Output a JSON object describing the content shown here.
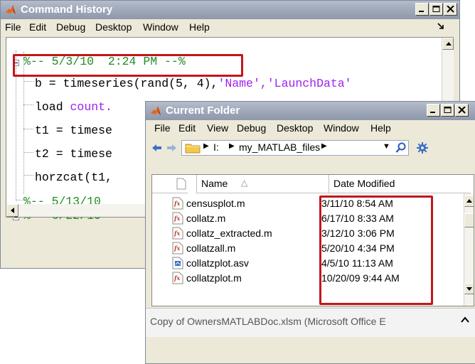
{
  "history": {
    "title": "Command History",
    "menu": [
      "File",
      "Edit",
      "Debug",
      "Desktop",
      "Window",
      "Help"
    ],
    "session1": "%-- 5/3/10  2:24 PM --%",
    "lines": [
      {
        "a": "b = timeseries(rand(5, 4),",
        "b": "'Name','LaunchData'"
      },
      {
        "a": "load ",
        "b": "count."
      },
      {
        "a": "t1 = timese",
        "b": ""
      },
      {
        "a": "t2 = timese",
        "b": ""
      },
      {
        "a": "horzcat(t1,",
        "b": ""
      }
    ],
    "session2": "%-- 5/13/10",
    "session3": "%-- 6/22/10"
  },
  "folder": {
    "title": "Current Folder",
    "menu": [
      "File",
      "Edit",
      "View",
      "Debug",
      "Desktop",
      "Window",
      "Help"
    ],
    "path": [
      "I:",
      "my_MATLAB_files"
    ],
    "columns": {
      "name": "Name",
      "sort": "△",
      "date": "Date Modified"
    },
    "files": [
      {
        "name": "censusplot.m",
        "date": "3/11/10 8:54 AM",
        "icon": "m-file-icon"
      },
      {
        "name": "collatz.m",
        "date": "6/17/10 8:33 AM",
        "icon": "m-file-icon"
      },
      {
        "name": "collatz_extracted.m",
        "date": "3/12/10 3:06 PM",
        "icon": "m-file-icon"
      },
      {
        "name": "collatzall.m",
        "date": "5/20/10 4:34 PM",
        "icon": "m-file-icon"
      },
      {
        "name": "collatzplot.asv",
        "date": "4/5/10 11:13 AM",
        "icon": "asv-file-icon"
      },
      {
        "name": "collatzplot.m",
        "date": "10/20/09 9:44 AM",
        "icon": "m-file-icon"
      }
    ],
    "status": "Copy of OwnersMATLABDoc.xlsm (Microsoft Office E"
  },
  "colors": {
    "highlight": "#c3161c",
    "comment": "#228b22",
    "string": "#a020f0"
  }
}
